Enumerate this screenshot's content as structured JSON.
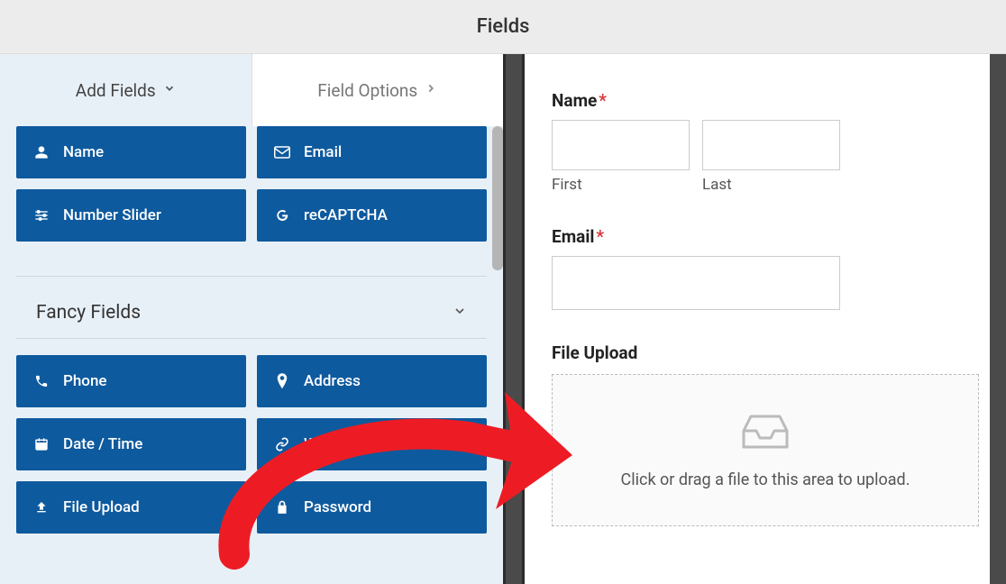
{
  "header": {
    "title": "Fields"
  },
  "tabs": {
    "add_fields": "Add Fields",
    "field_options": "Field Options"
  },
  "standard_fields": {
    "name": "Name",
    "email": "Email",
    "number_slider": "Number Slider",
    "recaptcha": "reCAPTCHA"
  },
  "section": {
    "fancy_fields": "Fancy Fields"
  },
  "fancy_fields": {
    "phone": "Phone",
    "address": "Address",
    "date_time": "Date / Time",
    "website_url": "Website / URL",
    "file_upload": "File Upload",
    "password": "Password"
  },
  "preview": {
    "name_label": "Name",
    "first_label": "First",
    "last_label": "Last",
    "email_label": "Email",
    "file_upload_label": "File Upload",
    "upload_hint": "Click or drag a file to this area to upload."
  }
}
